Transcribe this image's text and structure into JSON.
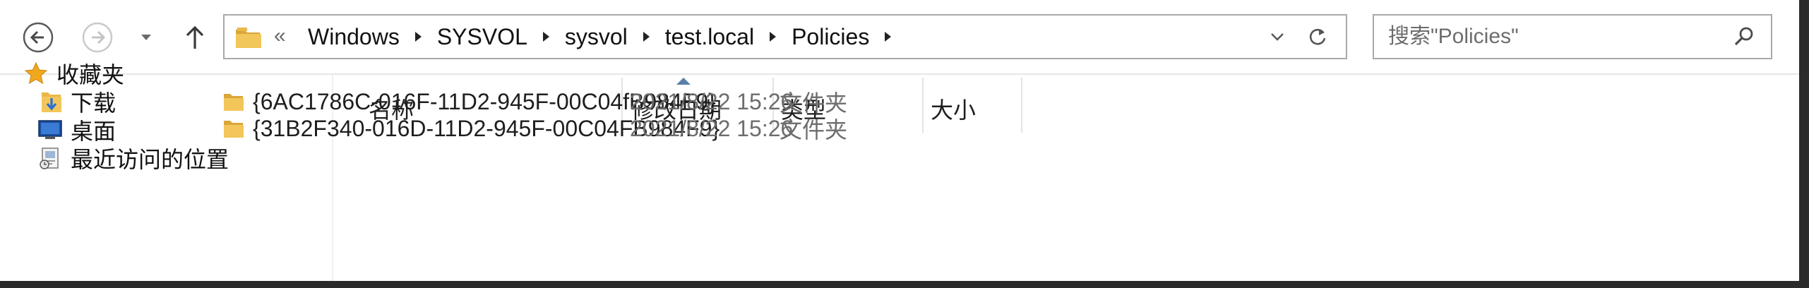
{
  "address": {
    "overflow": "«",
    "crumbs": [
      "Windows",
      "SYSVOL",
      "sysvol",
      "test.local",
      "Policies"
    ]
  },
  "search": {
    "placeholder": "搜索\"Policies\""
  },
  "nav_pane": {
    "items": [
      {
        "label": "收藏夹",
        "icon": "star-icon"
      },
      {
        "label": "下载",
        "icon": "downloads-folder-icon"
      },
      {
        "label": "桌面",
        "icon": "desktop-icon"
      },
      {
        "label": "最近访问的位置",
        "icon": "recent-places-icon"
      }
    ]
  },
  "columns": {
    "name": "名称",
    "modified": "修改日期",
    "type": "类型",
    "size": "大小"
  },
  "files": [
    {
      "name": "{6AC1786C-016F-11D2-945F-00C04fB984F9}",
      "modified": "2021/8/22 15:26",
      "type": "文件夹",
      "size": ""
    },
    {
      "name": "{31B2F340-016D-11D2-945F-00C04FB984F9}",
      "modified": "2021/8/22 15:26",
      "type": "文件夹",
      "size": ""
    }
  ],
  "colors": {
    "folder": "#e8b84a",
    "star": "#f0a81e",
    "sort_caret": "#5b7fa8"
  }
}
